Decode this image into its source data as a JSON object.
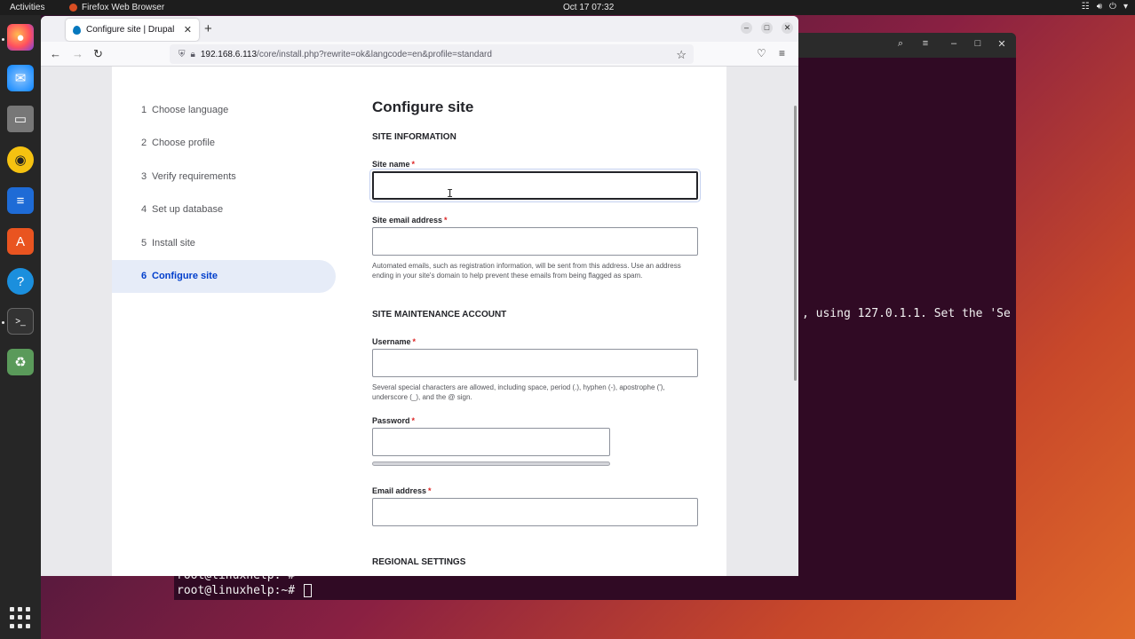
{
  "topbar": {
    "activities": "Activities",
    "app_name": "Firefox Web Browser",
    "clock": "Oct 17  07:32",
    "tray_icons": [
      "network-icon",
      "volume-icon",
      "power-icon",
      "menu-down-icon"
    ]
  },
  "dock": {
    "apps": [
      "firefox-icon",
      "thunderbird-icon",
      "files-icon",
      "rhythmbox-icon",
      "writer-icon",
      "software-icon",
      "help-icon",
      "terminal-icon",
      "trash-icon"
    ],
    "app_grid": "show-apps-icon"
  },
  "browser": {
    "tab_title": "Configure site | Drupal",
    "url_host": "192.168.6.113",
    "url_path": "/core/install.php?rewrite=ok&langcode=en&profile=standard"
  },
  "installer": {
    "steps": [
      {
        "num": "1",
        "label": "Choose language"
      },
      {
        "num": "2",
        "label": "Choose profile"
      },
      {
        "num": "3",
        "label": "Verify requirements"
      },
      {
        "num": "4",
        "label": "Set up database"
      },
      {
        "num": "5",
        "label": "Install site"
      },
      {
        "num": "6",
        "label": "Configure site"
      }
    ],
    "active_step": 6,
    "title": "Configure site",
    "site_info_heading": "SITE INFORMATION",
    "site_name_label": "Site name",
    "site_name_value": "",
    "site_email_label": "Site email address",
    "site_email_value": "",
    "site_email_help": "Automated emails, such as registration information, will be sent from this address. Use an address ending in your site's domain to help prevent these emails from being flagged as spam.",
    "maintenance_heading": "SITE MAINTENANCE ACCOUNT",
    "username_label": "Username",
    "username_value": "",
    "username_help": "Several special characters are allowed, including space, period (.), hyphen (-), apostrophe ('), underscore (_), and the @ sign.",
    "password_label": "Password",
    "password_value": "",
    "email_label": "Email address",
    "email_value": "",
    "regional_heading": "REGIONAL SETTINGS",
    "required_marker": "*"
  },
  "terminal": {
    "log_fragment": ", using 127.0.1.1. Set the 'Se",
    "prompt_partial": "root@linuxhelp:~#",
    "prompt": "root@linuxhelp:~# "
  }
}
